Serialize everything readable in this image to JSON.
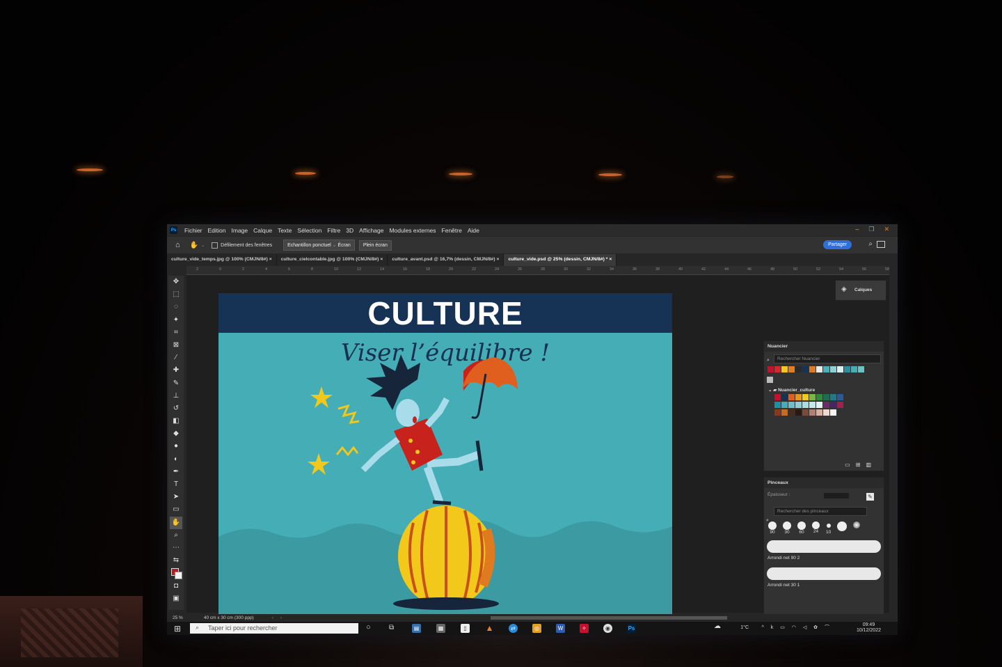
{
  "app": {
    "logo": "Ps"
  },
  "menu": [
    "Fichier",
    "Edition",
    "Image",
    "Calque",
    "Texte",
    "Sélection",
    "Filtre",
    "3D",
    "Affichage",
    "Modules externes",
    "Fenêtre",
    "Aide"
  ],
  "window_controls": {
    "minimize": "–",
    "restore": "❐",
    "close": "✕"
  },
  "options": {
    "scroll_all": "Défilement des fenêtres",
    "sample": "Echantillon ponctuel",
    "sample_target": "Écran",
    "fullscreen": "Plein écran",
    "share": "Partager"
  },
  "tabs": [
    {
      "label": "culture_vide_temps.jpg @ 100% (CMJN/8#)",
      "close": "×"
    },
    {
      "label": "culture_cielcontable.jpg @ 100% (CMJN/8#)",
      "close": "×"
    },
    {
      "label": "culture_avant.psd @ 16,7% (dessin, CMJN/8#)",
      "close": "×"
    },
    {
      "label": "culture_vide.psd @ 25% (dessin, CMJN/8#) *",
      "close": "×",
      "active": true
    }
  ],
  "ruler_ticks": [
    "2",
    "0",
    "2",
    "4",
    "6",
    "8",
    "10",
    "12",
    "14",
    "16",
    "18",
    "20",
    "22",
    "24",
    "26",
    "28",
    "30",
    "32",
    "34",
    "36",
    "38",
    "40",
    "42",
    "44",
    "46",
    "48",
    "50",
    "52",
    "54",
    "56",
    "58"
  ],
  "artwork": {
    "title": "CULTURE",
    "subtitle": "Viser l’équilibre !",
    "colors": {
      "band": "#163255",
      "sky": "#45adb5",
      "sea": "#3fa0a8",
      "ball": "#f2c81a"
    }
  },
  "panels": {
    "layers": {
      "label": "Calques"
    },
    "swatches": {
      "title": "Nuancier",
      "search_placeholder": "Rechercher Nuancier",
      "folder": "Nuancier_culture",
      "row1": [
        "#c8102e",
        "#d9262b",
        "#f2c81a",
        "#e47d1d",
        "#2a2a2a",
        "#163255",
        "#e07a1f",
        "#e9e9e9",
        "#46b0bb",
        "#8fd0d6",
        "#d8eef0",
        "#2a8fa0",
        "#45adb5",
        "#68c3c9"
      ],
      "grid": [
        [
          "#c8102e",
          "#163255",
          "#e05f1f",
          "#e8951a",
          "#f2c81a",
          "#7ab83e",
          "#2e8b3a",
          "#1d6e4f",
          "#1d7a8a",
          "#2a5a9a"
        ],
        [
          "#1a8fa5",
          "#45adb5",
          "#6bc1c9",
          "#8fd0d6",
          "#a7dde1",
          "#c3e8ea",
          "#e0f2f3",
          "#6e2a6a",
          "#4a2468",
          "#a02050"
        ],
        [
          "#8a3a1a",
          "#c86a20",
          "#4a2a1a",
          "#2a1a10",
          "#7a4a3a",
          "#b08070",
          "#d8b0a0",
          "#f0d8d0",
          "#f4f4f4"
        ]
      ]
    },
    "brushes": {
      "title": "Pinceaux",
      "thickness_label": "Épaisseur :",
      "search_placeholder": "Rechercher des pinceaux",
      "sizes": [
        "90",
        "30",
        "60",
        "24",
        "10"
      ],
      "brush1": "Arrondi net 90 2",
      "brush2": "Arrondi net 30 1"
    }
  },
  "status": {
    "zoom": "25 %",
    "doc": "40 cm x 30 cm (300 ppp)"
  },
  "taskbar": {
    "search": "Taper ici pour rechercher",
    "temperature": "1°C",
    "time": "09:49",
    "date": "10/12/2022"
  }
}
